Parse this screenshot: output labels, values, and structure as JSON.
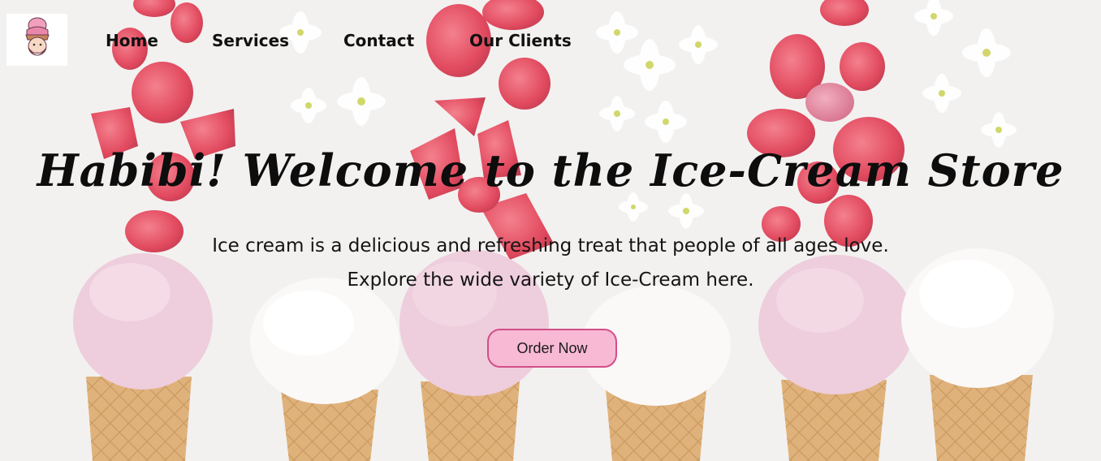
{
  "header": {
    "logo_icon": "ice-cream-mascot-icon"
  },
  "nav": {
    "items": [
      {
        "label": "Home"
      },
      {
        "label": "Services"
      },
      {
        "label": "Contact"
      },
      {
        "label": "Our Clients"
      }
    ]
  },
  "hero": {
    "title": "Habibi! Welcome to the Ice-Cream Store",
    "subtitle_line1": "Ice cream is a delicious and refreshing treat that people of all ages love.",
    "subtitle_line2": "Explore the wide variety of Ice-Cream here.",
    "cta_label": "Order Now"
  },
  "colors": {
    "background": "#f1efee",
    "strawberry": "#e0354c",
    "cone": "#dca869",
    "pink_scoop": "#ecc6d8",
    "white_scoop": "#fbf8f7",
    "button_fill": "#f8b9d4",
    "button_border": "#d24f88"
  }
}
